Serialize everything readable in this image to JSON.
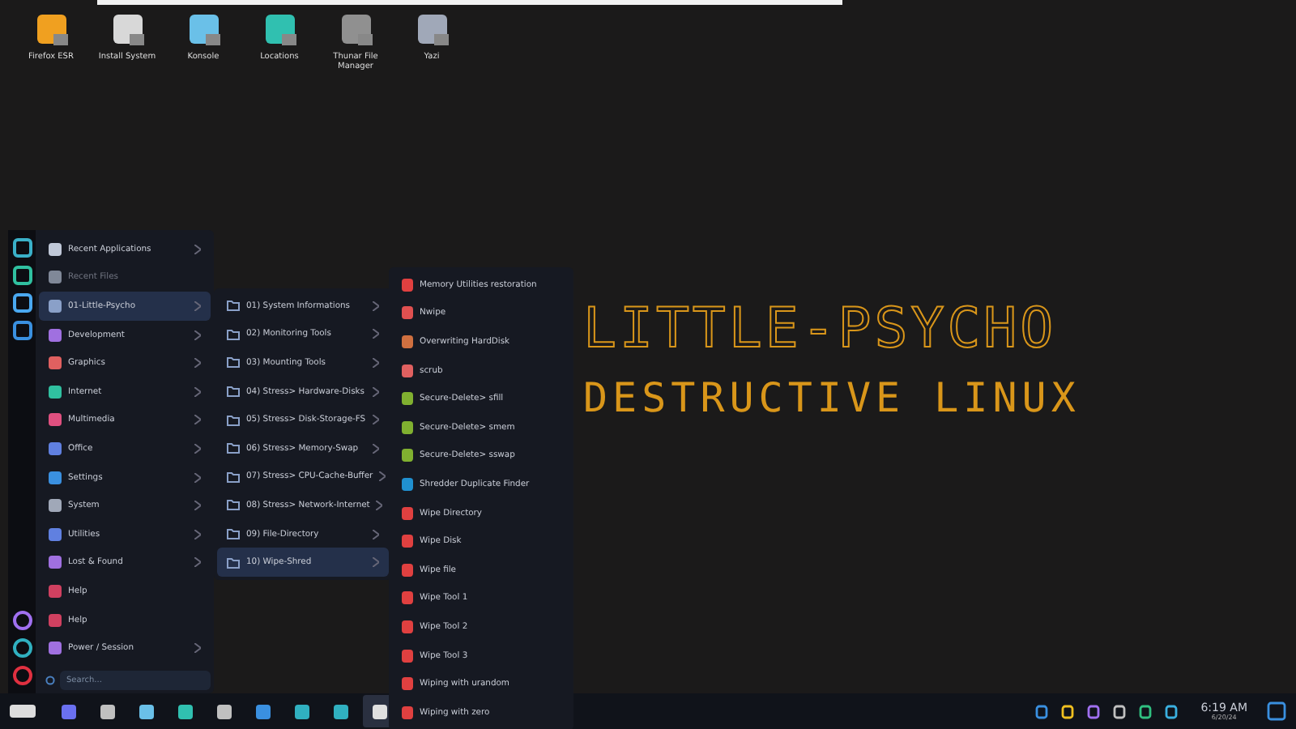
{
  "desktop_icons": [
    {
      "label": "Firefox ESR",
      "color": "#f0a020"
    },
    {
      "label": "Install System",
      "color": "#d8d8d8"
    },
    {
      "label": "Konsole",
      "color": "#6ac0e8"
    },
    {
      "label": "Locations",
      "color": "#30c0b0"
    },
    {
      "label": "Thunar File Manager",
      "color": "#909090"
    },
    {
      "label": "Yazi",
      "color": "#a0a8b8"
    }
  ],
  "wallpaper": {
    "title": "LITTLE-PSYCHO",
    "subtitle": "DESTRUCTIVE LINUX"
  },
  "menu": {
    "side_icons": [
      {
        "color": "#3ab0c8"
      },
      {
        "color": "#30c0a0"
      },
      {
        "color": "#4aa8f0"
      },
      {
        "color": "#3a90e0"
      }
    ],
    "side_icons_bottom": [
      {
        "color": "#a070f0"
      },
      {
        "color": "#30b0c0"
      },
      {
        "color": "#e03040"
      }
    ],
    "categories": [
      {
        "label": "Recent Applications",
        "color": "#c0c8d8",
        "submenu": true,
        "disabled": false,
        "selected": false
      },
      {
        "label": "Recent Files",
        "color": "#808898",
        "submenu": false,
        "disabled": true,
        "selected": false
      },
      {
        "label": "01-Little-Psycho",
        "color": "#8aa0c8",
        "submenu": true,
        "disabled": false,
        "selected": true
      },
      {
        "label": "Development",
        "color": "#a070e0",
        "submenu": true,
        "disabled": false,
        "selected": false
      },
      {
        "label": "Graphics",
        "color": "#e06060",
        "submenu": true,
        "disabled": false,
        "selected": false
      },
      {
        "label": "Internet",
        "color": "#30c0a0",
        "submenu": true,
        "disabled": false,
        "selected": false
      },
      {
        "label": "Multimedia",
        "color": "#e05080",
        "submenu": true,
        "disabled": false,
        "selected": false
      },
      {
        "label": "Office",
        "color": "#6080e0",
        "submenu": true,
        "disabled": false,
        "selected": false
      },
      {
        "label": "Settings",
        "color": "#3a90e0",
        "submenu": true,
        "disabled": false,
        "selected": false
      },
      {
        "label": "System",
        "color": "#a0a8b8",
        "submenu": true,
        "disabled": false,
        "selected": false
      },
      {
        "label": "Utilities",
        "color": "#6080e0",
        "submenu": true,
        "disabled": false,
        "selected": false
      },
      {
        "label": "Lost & Found",
        "color": "#a070e0",
        "submenu": true,
        "disabled": false,
        "selected": false
      },
      {
        "label": "Help",
        "color": "#d04060",
        "submenu": false,
        "disabled": false,
        "selected": false
      },
      {
        "label": "Help",
        "color": "#d04060",
        "submenu": false,
        "disabled": false,
        "selected": false
      },
      {
        "label": "Power / Session",
        "color": "#a070e0",
        "submenu": true,
        "disabled": false,
        "selected": false
      }
    ],
    "search": {
      "placeholder": "Search..."
    },
    "submenu": [
      {
        "label": "01) System Informations",
        "selected": false
      },
      {
        "label": "02) Monitoring Tools",
        "selected": false
      },
      {
        "label": "03) Mounting Tools",
        "selected": false
      },
      {
        "label": "04) Stress> Hardware-Disks",
        "selected": false
      },
      {
        "label": "05) Stress> Disk-Storage-FS",
        "selected": false
      },
      {
        "label": "06) Stress> Memory-Swap",
        "selected": false
      },
      {
        "label": "07) Stress> CPU-Cache-Buffer",
        "selected": false
      },
      {
        "label": "08) Stress> Network-Internet",
        "selected": false
      },
      {
        "label": "09) File-Directory",
        "selected": false
      },
      {
        "label": "10) Wipe-Shred",
        "selected": true
      }
    ],
    "apps": [
      {
        "label": "Memory Utilities restoration",
        "color": "#e04040"
      },
      {
        "label": "Nwipe",
        "color": "#e05050"
      },
      {
        "label": "Overwriting HardDisk",
        "color": "#d07040"
      },
      {
        "label": "scrub",
        "color": "#e06060"
      },
      {
        "label": "Secure-Delete> sfill",
        "color": "#80b030"
      },
      {
        "label": "Secure-Delete> smem",
        "color": "#80b030"
      },
      {
        "label": "Secure-Delete> sswap",
        "color": "#80b030"
      },
      {
        "label": "Shredder Duplicate Finder",
        "color": "#2090d0"
      },
      {
        "label": "Wipe Directory",
        "color": "#e04040"
      },
      {
        "label": "Wipe Disk",
        "color": "#e04040"
      },
      {
        "label": "Wipe file",
        "color": "#e04040"
      },
      {
        "label": "Wipe Tool 1",
        "color": "#e04040"
      },
      {
        "label": "Wipe Tool 2",
        "color": "#e04040"
      },
      {
        "label": "Wipe Tool 3",
        "color": "#e04040"
      },
      {
        "label": "Wiping with urandom",
        "color": "#e04040"
      },
      {
        "label": "Wiping with zero",
        "color": "#e04040"
      }
    ]
  },
  "taskbar": {
    "apps": [
      {
        "color": "#6a70f0",
        "selected": false
      },
      {
        "color": "#c0c0c0",
        "selected": false
      },
      {
        "color": "#6ac0e8",
        "selected": false
      },
      {
        "color": "#30c0b0",
        "selected": false
      },
      {
        "color": "#c0c0c0",
        "selected": false
      },
      {
        "color": "#3a90e0",
        "selected": false
      },
      {
        "color": "#30b0c0",
        "selected": false
      },
      {
        "color": "#30b0c0",
        "selected": false
      },
      {
        "color": "#e0e0e0",
        "selected": true
      }
    ],
    "tray": [
      {
        "color": "#3a90e0"
      },
      {
        "color": "#f0c020"
      },
      {
        "color": "#a070f0"
      },
      {
        "color": "#c0c0c0"
      },
      {
        "color": "#30c080"
      },
      {
        "color": "#3ab0e0"
      }
    ],
    "time": "6:19 AM",
    "date": "6/20/24"
  }
}
